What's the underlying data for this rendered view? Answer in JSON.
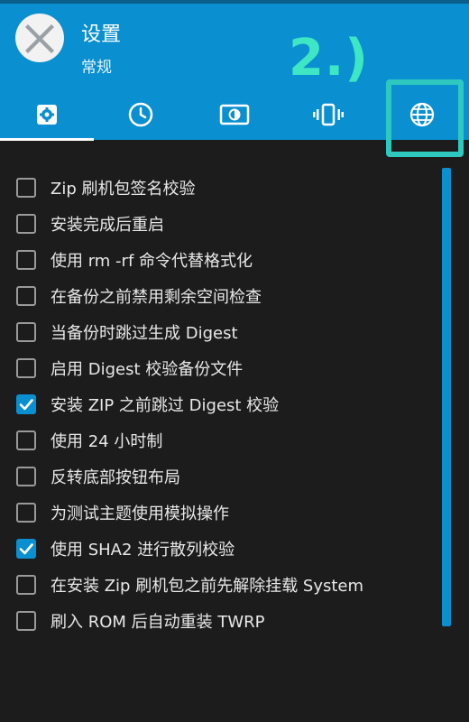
{
  "header": {
    "title": "设置",
    "subtitle": "常规",
    "annotation": "2.)",
    "logo_icon": "twrp-logo-icon"
  },
  "tabs": [
    {
      "icon": "gear-icon",
      "selected": true
    },
    {
      "icon": "clock-icon",
      "selected": false
    },
    {
      "icon": "brightness-icon",
      "selected": false
    },
    {
      "icon": "vibration-icon",
      "selected": false
    },
    {
      "icon": "globe-icon",
      "selected": false
    }
  ],
  "options": [
    {
      "label": "Zip 刷机包签名校验",
      "checked": false
    },
    {
      "label": "安装完成后重启",
      "checked": false
    },
    {
      "label": "使用 rm -rf 命令代替格式化",
      "checked": false
    },
    {
      "label": "在备份之前禁用剩余空间检查",
      "checked": false
    },
    {
      "label": "当备份时跳过生成 Digest",
      "checked": false
    },
    {
      "label": "启用 Digest 校验备份文件",
      "checked": false
    },
    {
      "label": "安装 ZIP 之前跳过 Digest 校验",
      "checked": true
    },
    {
      "label": "使用 24 小时制",
      "checked": false
    },
    {
      "label": "反转底部按钮布局",
      "checked": false
    },
    {
      "label": "为测试主题使用模拟操作",
      "checked": false
    },
    {
      "label": "使用 SHA2 进行散列校验",
      "checked": true
    },
    {
      "label": "在安装 Zip 刷机包之前先解除挂载 System",
      "checked": false
    },
    {
      "label": "刷入 ROM 后自动重装 TWRP",
      "checked": false
    }
  ],
  "colors": {
    "header_bg": "#0a8fd0",
    "body_bg": "#1c1c1c",
    "accent": "#0a8fd0",
    "annotation": "#3ee6c4",
    "highlight_box": "#2ec8bf"
  }
}
